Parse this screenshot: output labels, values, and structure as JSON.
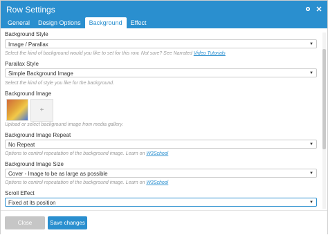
{
  "window": {
    "title": "Row Settings",
    "tabs": [
      {
        "label": "General"
      },
      {
        "label": "Design Options"
      },
      {
        "label": "Background"
      },
      {
        "label": "Effect"
      }
    ],
    "active_tab": "Background",
    "colors": {
      "header": "#2a8fcf",
      "active_tab_text": "#2a8fcf"
    }
  },
  "fields": {
    "background_style": {
      "label": "Background Style",
      "value": "Image / Parallax",
      "desc_prefix": "Select the kind of background would you like to set for this row. Not sure? See Narrated ",
      "desc_link": "Video Tutorials"
    },
    "parallax_style": {
      "label": "Parallax Style",
      "value": "Simple Background Image",
      "desc": "Select the kind of style you like for the background."
    },
    "background_image": {
      "label": "Background Image",
      "desc": "Upload or select background image from media gallery."
    },
    "background_image_repeat": {
      "label": "Background Image Repeat",
      "value": "No Repeat",
      "desc_prefix": "Options to control repeatation of the background image. Learn on ",
      "desc_link": "W3School"
    },
    "background_image_size": {
      "label": "Background Image Size",
      "value": "Cover - Image to be as large as possible",
      "desc_prefix": "Options to control repeatation of the background image. Learn on ",
      "desc_link": "W3School"
    },
    "scroll_effect": {
      "label": "Scroll Effect",
      "value": "Fixed at its position"
    }
  },
  "buttons": {
    "close": "Close",
    "save": "Save changes"
  },
  "icons": {
    "settings": "gear-icon",
    "close": "close-icon",
    "add": "plus-icon",
    "select_caret": "caret-down-icon"
  }
}
